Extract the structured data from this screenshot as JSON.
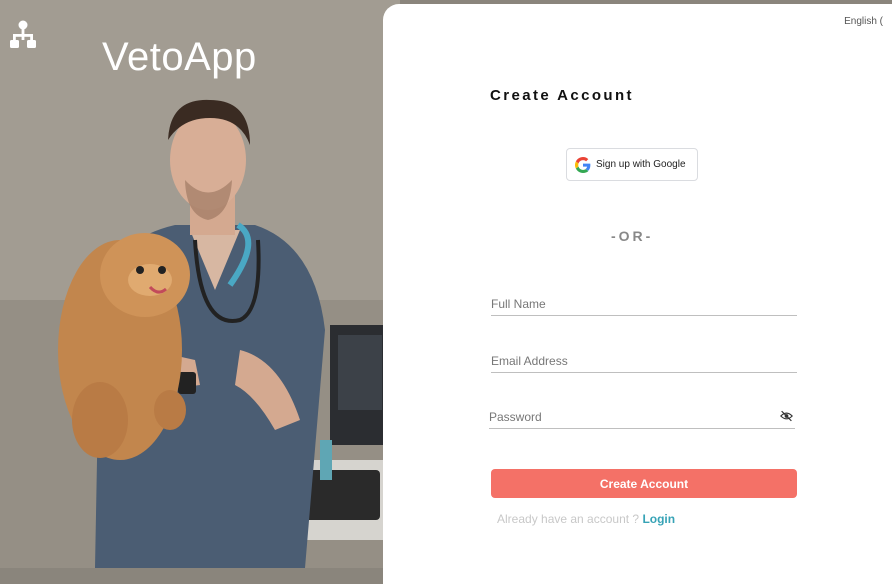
{
  "brand": {
    "name": "VetoApp",
    "logo_icon": "sitemap-icon"
  },
  "language": {
    "label": "English ("
  },
  "form": {
    "title": "Create  Account",
    "google_button": {
      "label": "Sign up with Google",
      "icon": "google-icon"
    },
    "divider": "-OR-",
    "full_name": {
      "placeholder": "Full Name",
      "value": ""
    },
    "email": {
      "placeholder": "Email Address",
      "value": ""
    },
    "password": {
      "placeholder": "Password",
      "value": "",
      "toggle_icon": "eye-slash-icon"
    },
    "submit_label": "Create Account",
    "login_prompt": "Already have an account ? ",
    "login_link": "Login"
  },
  "colors": {
    "accent": "#f47167",
    "link": "#37a3b6"
  }
}
